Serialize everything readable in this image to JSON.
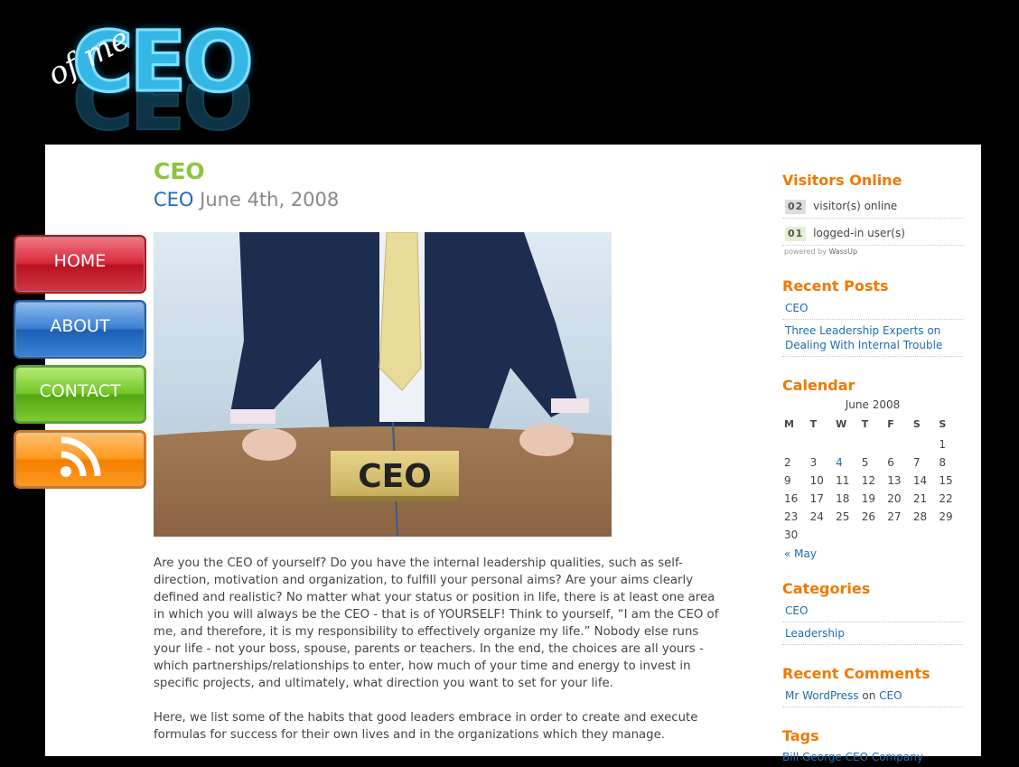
{
  "logo": {
    "main": "CEO",
    "script": "of me"
  },
  "nav": {
    "home": "HOME",
    "about": "ABOUT",
    "contact": "CONTACT"
  },
  "post": {
    "title": "CEO",
    "category": "CEO",
    "date": "June 4th, 2008",
    "image_label": "CEO",
    "paragraph1": "Are you the CEO of yourself? Do you have the internal leadership qualities, such as self-direction, motivation and organization, to fulfill your personal aims? Are your aims clearly defined and realistic? No matter what your status or position in life, there is at least one area in which you will always be the CEO - that is of YOURSELF! Think to yourself, “I am the CEO of me, and therefore, it is my responsibility to effectively organize my life.” Nobody else runs your life - not your boss, spouse, parents or teachers. In the end, the choices are all yours - which partnerships/relationships to enter, how much of your time and energy to invest in specific projects, and ultimately, what direction you want to set for your life.",
    "paragraph2": "Here, we list some of the habits that good leaders embrace in order to create and execute formulas for success for their own lives and in the organizations which they manage."
  },
  "sidebar": {
    "visitors": {
      "title": "Visitors Online",
      "visitors_count": "02",
      "visitors_label": "visitor(s) online",
      "users_count": "01",
      "users_label": "logged-in user(s)",
      "powered_prefix": "powered by",
      "powered_name": "WassUp"
    },
    "recent_posts": {
      "title": "Recent Posts",
      "items": [
        "CEO",
        "Three Leadership Experts on Dealing With Internal Trouble"
      ]
    },
    "calendar": {
      "title": "Calendar",
      "caption": "June 2008",
      "days": [
        "M",
        "T",
        "W",
        "T",
        "F",
        "S",
        "S"
      ],
      "prev": "« May"
    },
    "categories": {
      "title": "Categories",
      "items": [
        "CEO",
        "Leadership"
      ]
    },
    "recent_comments": {
      "title": "Recent Comments",
      "author": "Mr WordPress",
      "on": "on",
      "post": "CEO"
    },
    "tags": {
      "title": "Tags",
      "text": "Bill George CEO Company"
    }
  },
  "colors": {
    "post_title": "#8cc63f",
    "link": "#1f6db1",
    "widget_title": "#f07a00"
  }
}
